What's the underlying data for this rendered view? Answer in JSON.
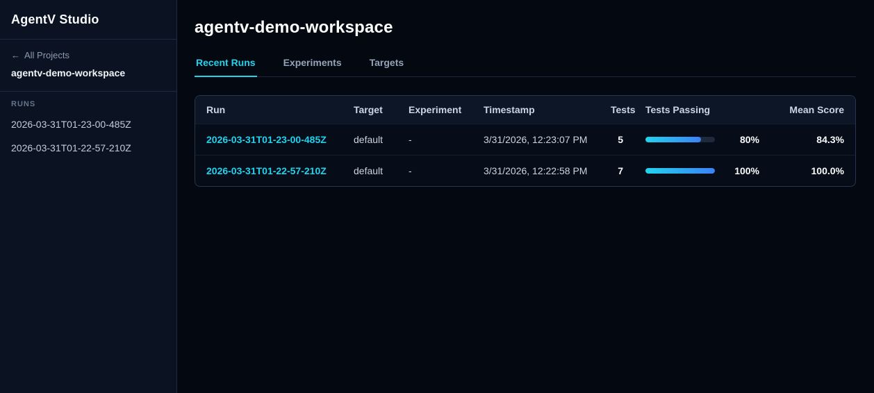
{
  "app": {
    "title": "AgentV Studio"
  },
  "sidebar": {
    "back_arrow": "←",
    "back_label": "All Projects",
    "workspace_name": "agentv-demo-workspace",
    "runs_label": "RUNS",
    "runs": [
      "2026-03-31T01-23-00-485Z",
      "2026-03-31T01-22-57-210Z"
    ]
  },
  "main": {
    "title": "agentv-demo-workspace",
    "tabs": [
      {
        "label": "Recent Runs"
      },
      {
        "label": "Experiments"
      },
      {
        "label": "Targets"
      }
    ],
    "active_tab": "Recent Runs"
  },
  "table": {
    "columns": [
      "Run",
      "Target",
      "Experiment",
      "Timestamp",
      "Tests",
      "Tests Passing",
      "Mean Score"
    ],
    "rows": [
      {
        "run": "2026-03-31T01-23-00-485Z",
        "target": "default",
        "experiment": "-",
        "timestamp": "3/31/2026, 12:23:07 PM",
        "tests": "5",
        "passing_value": 80,
        "passing_pct": "80%",
        "mean_score": "84.3%"
      },
      {
        "run": "2026-03-31T01-22-57-210Z",
        "target": "default",
        "experiment": "-",
        "timestamp": "3/31/2026, 12:22:58 PM",
        "tests": "7",
        "passing_value": 100,
        "passing_pct": "100%",
        "mean_score": "100.0%"
      }
    ]
  },
  "colors": {
    "accent": "#22d3ee",
    "progress_gradient_start": "#22d3ee",
    "progress_gradient_end": "#3b82f6",
    "sidebar_bg": "#0b1322",
    "page_bg": "#040810"
  }
}
